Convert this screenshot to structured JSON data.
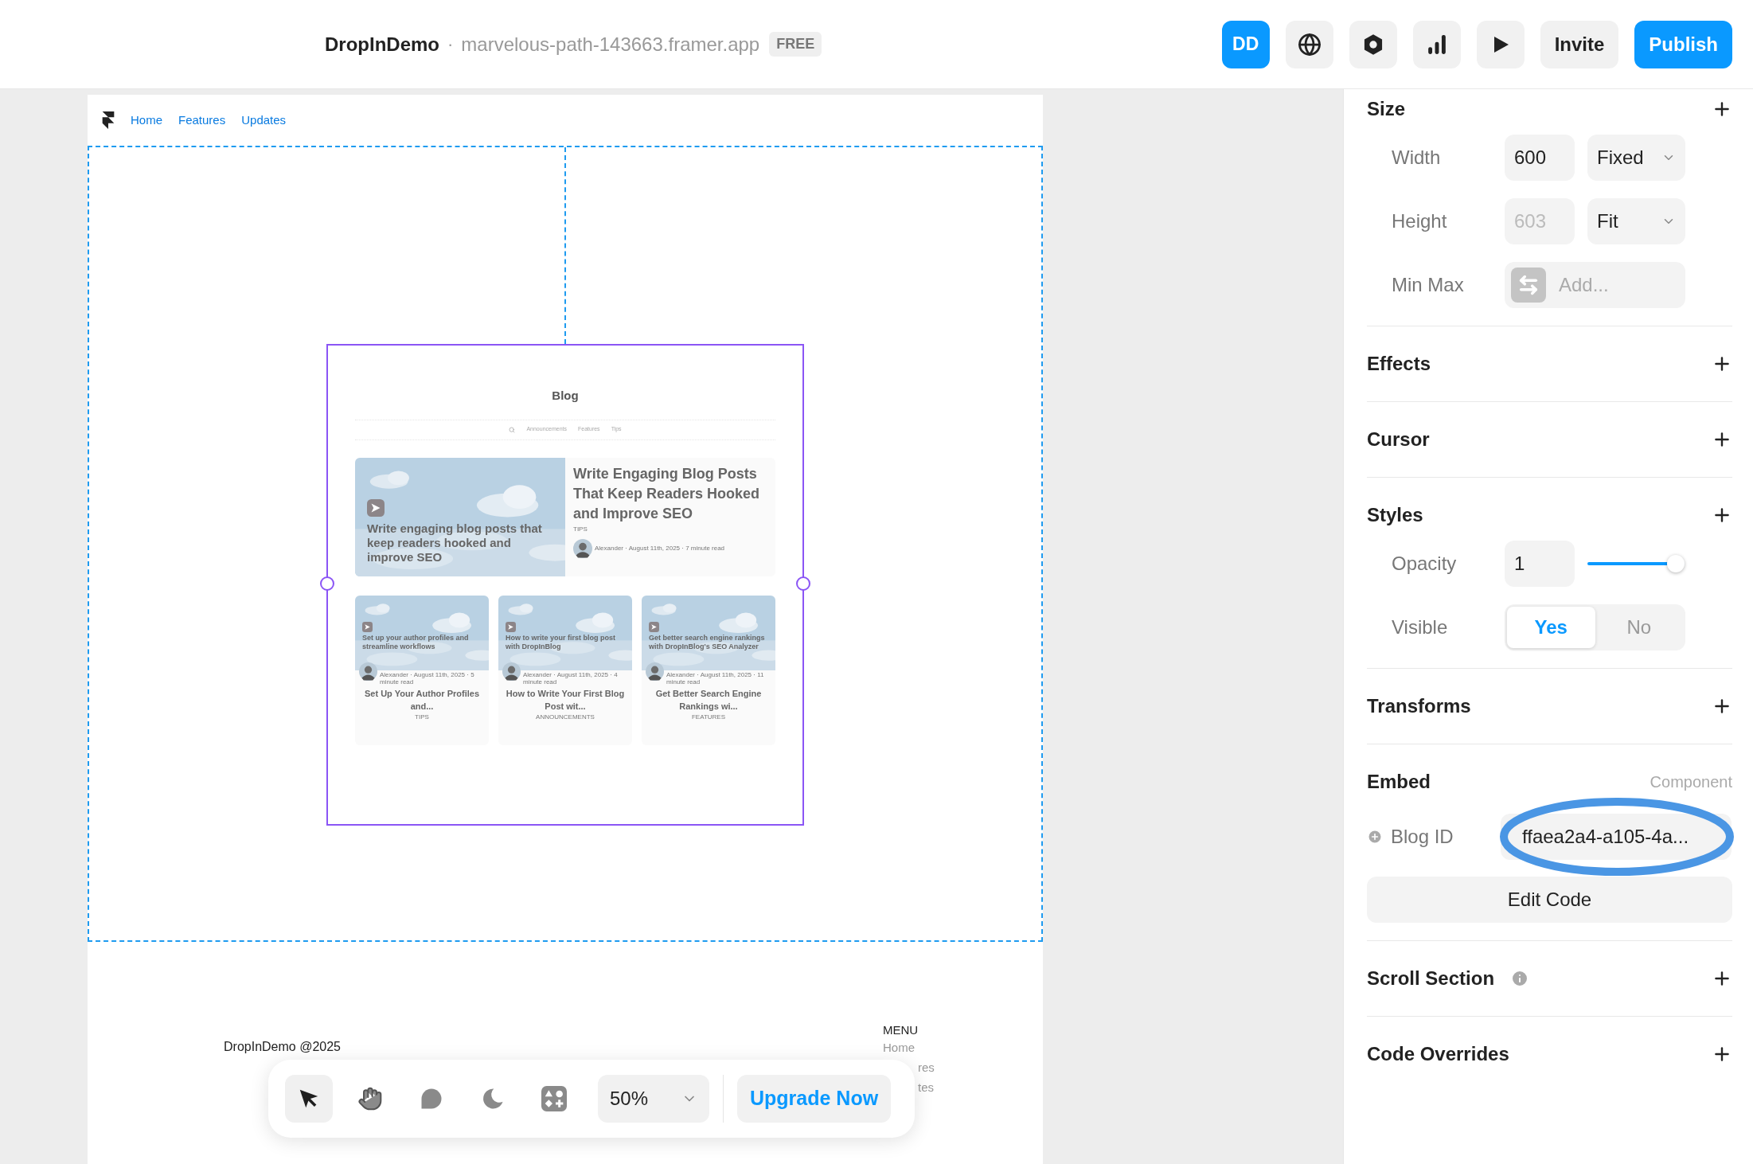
{
  "header": {
    "project": "DropInDemo",
    "separator": "·",
    "domain": "marvelous-path-143663.framer.app",
    "plan_badge": "FREE",
    "avatar": "DD",
    "buttons": [
      {
        "label": "Invite",
        "kind": "secondary"
      },
      {
        "label": "Publish",
        "kind": "primary"
      }
    ]
  },
  "site": {
    "nav": [
      "Home",
      "Features",
      "Updates"
    ],
    "footer_text": "DropInDemo @2025",
    "menu_title": "MENU",
    "menu_items": [
      "Home",
      "res",
      "tes"
    ]
  },
  "blog": {
    "title": "Blog",
    "categories": [
      "Announcements",
      "Features",
      "Tips"
    ],
    "featured": {
      "image_caption": "Write engaging blog posts that keep readers hooked and improve SEO",
      "title": "Write Engaging Blog Posts That Keep Readers Hooked and Improve SEO",
      "tag": "TIPS",
      "meta": "Alexander · August 11th, 2025 · 7 minute read"
    },
    "posts": [
      {
        "image_caption": "Set up your author profiles and streamline workflows",
        "meta": "Alexander · August 11th, 2025 · 5 minute read",
        "title": "Set Up Your Author Profiles and...",
        "tag": "TIPS"
      },
      {
        "image_caption": "How to write your first blog post with DropInBlog",
        "meta": "Alexander · August 11th, 2025 · 4 minute read",
        "title": "How to Write Your First Blog Post wit...",
        "tag": "ANNOUNCEMENTS"
      },
      {
        "image_caption": "Get better search engine rankings with DropInBlog's SEO Analyzer",
        "meta": "Alexander · August 11th, 2025 · 11 minute read",
        "title": "Get Better Search Engine Rankings wi...",
        "tag": "FEATURES"
      }
    ]
  },
  "toolbar": {
    "tools": [
      {
        "kind": "pointer",
        "selected": true
      },
      {
        "kind": "hand",
        "selected": false
      },
      {
        "kind": "comment",
        "selected": false
      },
      {
        "kind": "moon",
        "selected": false
      },
      {
        "kind": "assets",
        "selected": false
      }
    ],
    "zoom": "50%",
    "upgrade": "Upgrade Now"
  },
  "panel": {
    "sections": [
      {
        "kind": "size",
        "title": "Size",
        "rows": [
          {
            "label": "Width",
            "value": "600",
            "disabled": false,
            "mode": "Fixed"
          },
          {
            "label": "Height",
            "value": "603",
            "disabled": true,
            "mode": "Fit"
          }
        ],
        "min_max": {
          "label": "Min Max",
          "placeholder": "Add..."
        }
      },
      {
        "kind": "plain",
        "title": "Effects"
      },
      {
        "kind": "plain",
        "title": "Cursor"
      },
      {
        "kind": "styles",
        "title": "Styles",
        "opacity": {
          "label": "Opacity",
          "value": "1",
          "level": 1
        },
        "visible": {
          "label": "Visible",
          "options": [
            {
              "label": "Yes",
              "selected": true
            },
            {
              "label": "No",
              "selected": false
            }
          ]
        }
      },
      {
        "kind": "plain",
        "title": "Transforms"
      },
      {
        "kind": "embed",
        "title": "Embed",
        "subtitle": "Component",
        "field_label": "Blog ID",
        "field_value": "ffaea2a4-a105-4a...",
        "button": "Edit Code"
      },
      {
        "kind": "info",
        "title": "Scroll Section"
      },
      {
        "kind": "plain",
        "title": "Code Overrides"
      }
    ]
  }
}
